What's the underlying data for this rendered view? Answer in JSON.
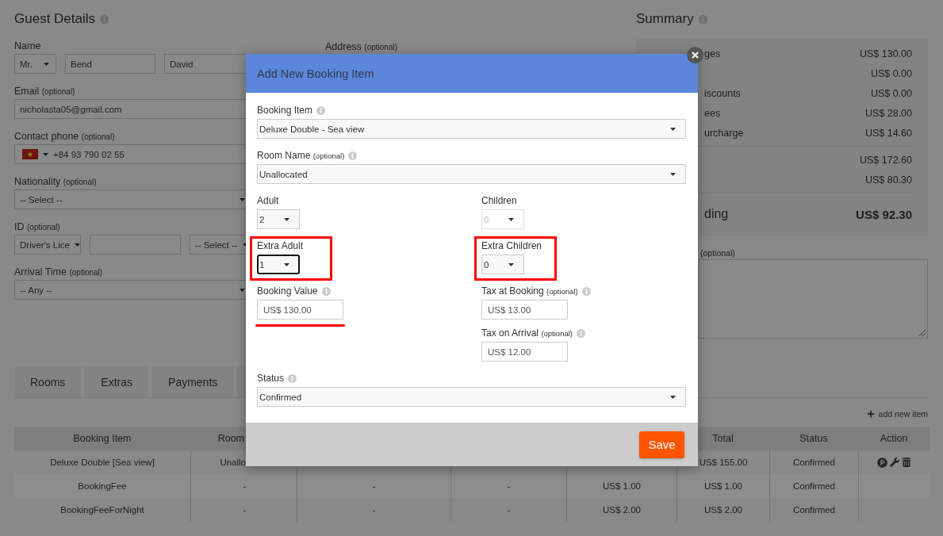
{
  "guest_details": {
    "title": "Guest Details",
    "info": true,
    "name": {
      "label": "Name",
      "title": "Mr.",
      "first_name": "Bend",
      "last_name": "David"
    },
    "email": {
      "label": "Email",
      "note": "(optional)",
      "value": "nicholasta05@gmail.com"
    },
    "contact_phone": {
      "label": "Contact phone",
      "note": "(optional)",
      "value": "+84 93 790 02 55"
    },
    "nationality": {
      "label": "Nationality",
      "note": "(optional)",
      "value": "-- Select --"
    },
    "id": {
      "label": "ID",
      "note": "(optional)",
      "type": "Driver's Lice",
      "country": "-- Select --"
    },
    "arrival_time": {
      "label": "Arrival Time",
      "note": "(optional)",
      "value": "-- Any --"
    }
  },
  "address": {
    "label": "Address",
    "note": "(optional)"
  },
  "summary": {
    "title": "Summary",
    "info": true,
    "charges": [
      {
        "label": "ges",
        "value": "US$ 130.00"
      },
      {
        "value": "US$ 0.00"
      },
      {
        "label": "iscounts",
        "value": "US$ 0.00"
      },
      {
        "label": "ees",
        "value": "US$ 28.00"
      },
      {
        "label": "urcharge",
        "value": "US$ 14.60"
      }
    ],
    "totals": [
      {
        "value": "US$ 172.60"
      },
      {
        "value": "US$ 80.30"
      }
    ],
    "outstanding": {
      "label": "ding",
      "value": "US$ 92.30"
    },
    "notes": {
      "note": "(optional)"
    }
  },
  "tabs": [
    {
      "label": "Rooms"
    },
    {
      "label": "Extras"
    },
    {
      "label": "Payments"
    }
  ],
  "add_item": {
    "label": "add new item"
  },
  "table": {
    "columns": [
      "Booking Item",
      "Room",
      null,
      null,
      null,
      "Total",
      "Status",
      "Action"
    ],
    "rows": [
      {
        "cells": [
          "Deluxe Double [Sea view]",
          "Unallo",
          null,
          null,
          null,
          "US$ 155.00",
          "Confirmed"
        ],
        "actions": true
      },
      {
        "cells": [
          "BookingFee",
          "-",
          "-",
          "-",
          "US$ 1.00",
          "US$ 1.00",
          "Confirmed"
        ],
        "actions": false
      },
      {
        "cells": [
          "BookingFeeForNight",
          "-",
          "-",
          "-",
          "US$ 2.00",
          "US$ 2.00",
          "Confirmed"
        ],
        "actions": false
      }
    ]
  },
  "modal": {
    "title": "Add New Booking Item",
    "booking_item": {
      "label": "Booking Item",
      "info": true,
      "value": "Deluxe Double - Sea view"
    },
    "room_name": {
      "label": "Room Name",
      "note": "(optional)",
      "info": true,
      "value": "Unallocated"
    },
    "occupancy": [
      {
        "label": "Adult",
        "value": "2",
        "disabled": false,
        "focused": false,
        "framed": false
      },
      {
        "label": "Children",
        "value": "0",
        "disabled": true,
        "focused": false,
        "framed": false
      },
      {
        "label": "Extra Adult",
        "value": "1",
        "disabled": false,
        "focused": true,
        "framed": true
      },
      {
        "label": "Extra Children",
        "value": "0",
        "disabled": false,
        "focused": false,
        "framed": true
      }
    ],
    "booking_value": {
      "label": "Booking Value",
      "info": true,
      "value": "US$ 130.00",
      "underlined": true
    },
    "taxes": [
      {
        "label": "Tax at Booking",
        "note": "(optional)",
        "info": true,
        "value": "US$ 13.00"
      },
      {
        "label": "Tax on Arrival",
        "note": "(optional)",
        "info": true,
        "value": "US$ 12.00"
      }
    ],
    "status": {
      "label": "Status",
      "info": true,
      "value": "Confirmed"
    },
    "save_button": "Save"
  }
}
